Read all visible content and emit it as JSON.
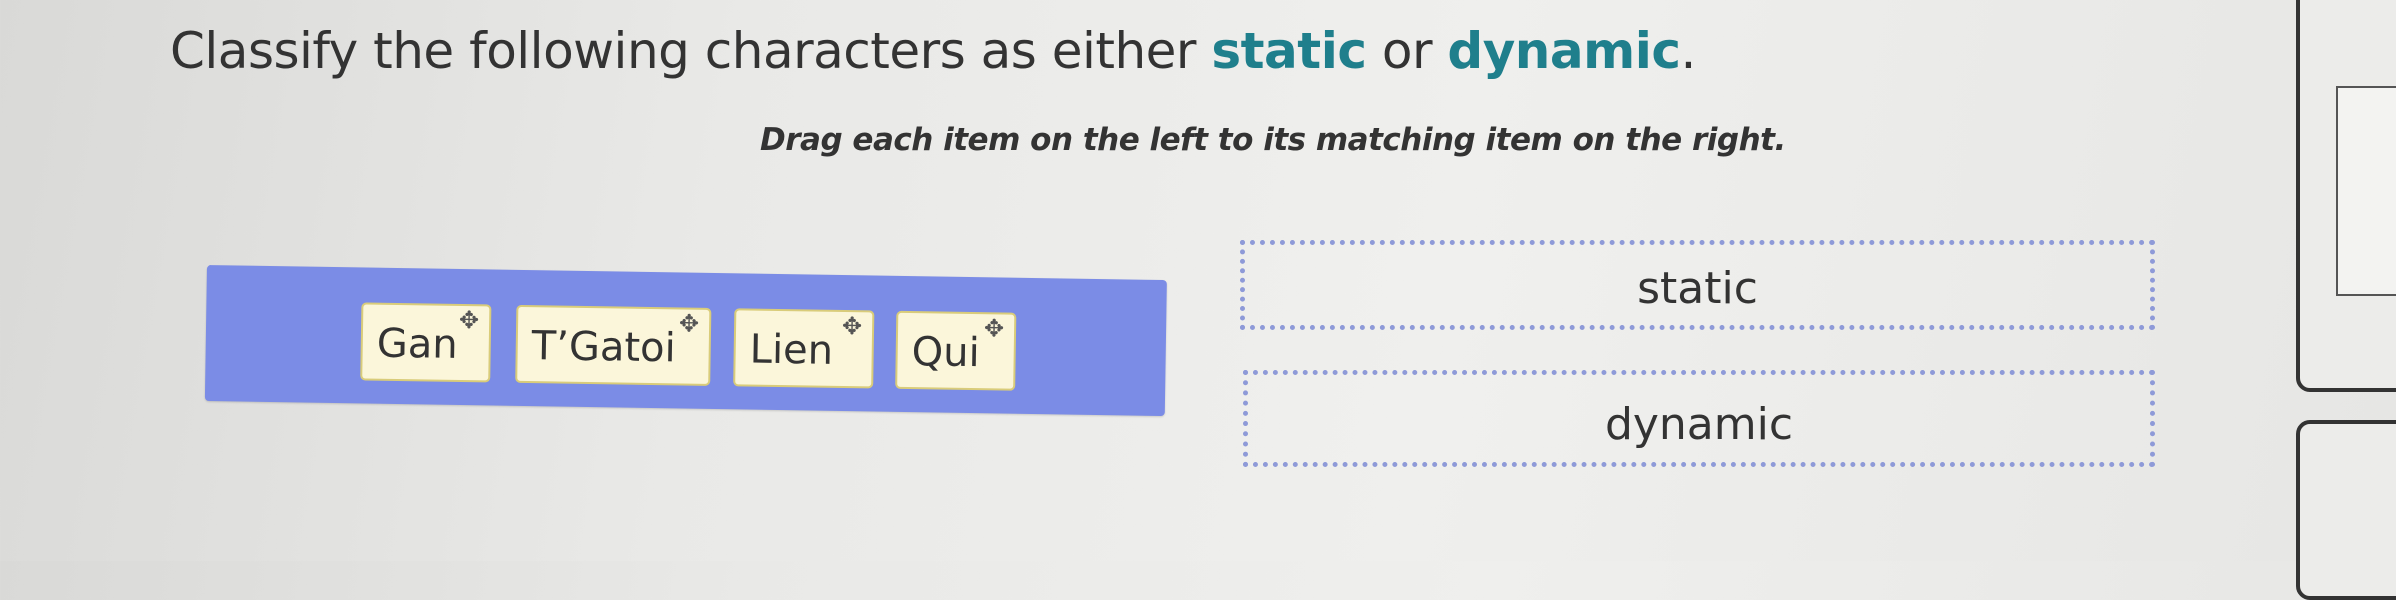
{
  "question": {
    "prefix": "Classify the following characters as either ",
    "keyword_1": "static",
    "middle": " or ",
    "keyword_2": "dynamic",
    "suffix": "."
  },
  "instruction": "Drag each item on the left to its matching item on the right.",
  "draggables": [
    {
      "label": "Gan"
    },
    {
      "label": "T’Gatoi"
    },
    {
      "label": "Lien"
    },
    {
      "label": "Qui"
    }
  ],
  "targets": [
    {
      "label": "static"
    },
    {
      "label": "dynamic"
    }
  ],
  "icons": {
    "move": "move-icon"
  },
  "colors": {
    "keyword": "#1f7f8c",
    "tray": "#7b8ce6",
    "chip_bg": "#fbf6da",
    "chip_border": "#d9cc7a",
    "drop_border": "#8e9ad8"
  }
}
